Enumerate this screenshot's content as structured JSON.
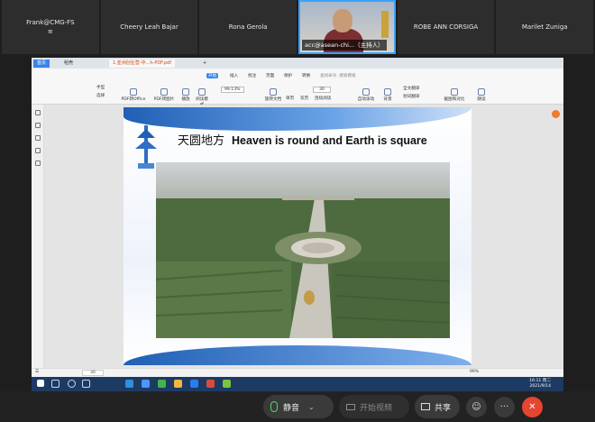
{
  "participants": [
    {
      "name": "Frank@CMG-FS",
      "sub": "≡"
    },
    {
      "name": "Cheery Leah Bajar"
    },
    {
      "name": "Rona Gerola"
    },
    {
      "name": "acc@asean-chi...（主持人）",
      "video": true
    },
    {
      "name": "ROBE ANN CORSIGA"
    },
    {
      "name": "Marilet Zuniga"
    }
  ],
  "app": {
    "tabs": {
      "home": "首页",
      "doc": "稻壳",
      "pdf": "1.亚洲创业营-中...h-PDF.pdf"
    },
    "menu": [
      "开始",
      "插入",
      "批注",
      "页面",
      "保护",
      "转换"
    ],
    "search_placeholder": "查找命令, 搜索模板",
    "page_zoom": "99.13%",
    "page_number": "30",
    "buttons": [
      "手型",
      "选择",
      "PDF转Office",
      "PDF转图片",
      "播放",
      "阅读模式",
      "旋转文档",
      "单页",
      "双页",
      "连续阅读",
      "自动滚动",
      "背景",
      "全文翻译",
      "划词翻译",
      "截图和对比",
      "朗读"
    ],
    "status_page": "30",
    "status_zoom": "99%",
    "clock_time": "16:11 周二",
    "clock_date": "2021/9/14"
  },
  "slide": {
    "title_cn": "天圆地方",
    "title_en": "Heaven is round and Earth is square"
  },
  "controls": {
    "mute": "静音",
    "video": "开始视频",
    "share": "共享",
    "more": "···",
    "end": "✕"
  },
  "colors": {
    "accent": "#3b84e6",
    "end": "#e6452f",
    "slide_blue": "#1f5fb5"
  }
}
